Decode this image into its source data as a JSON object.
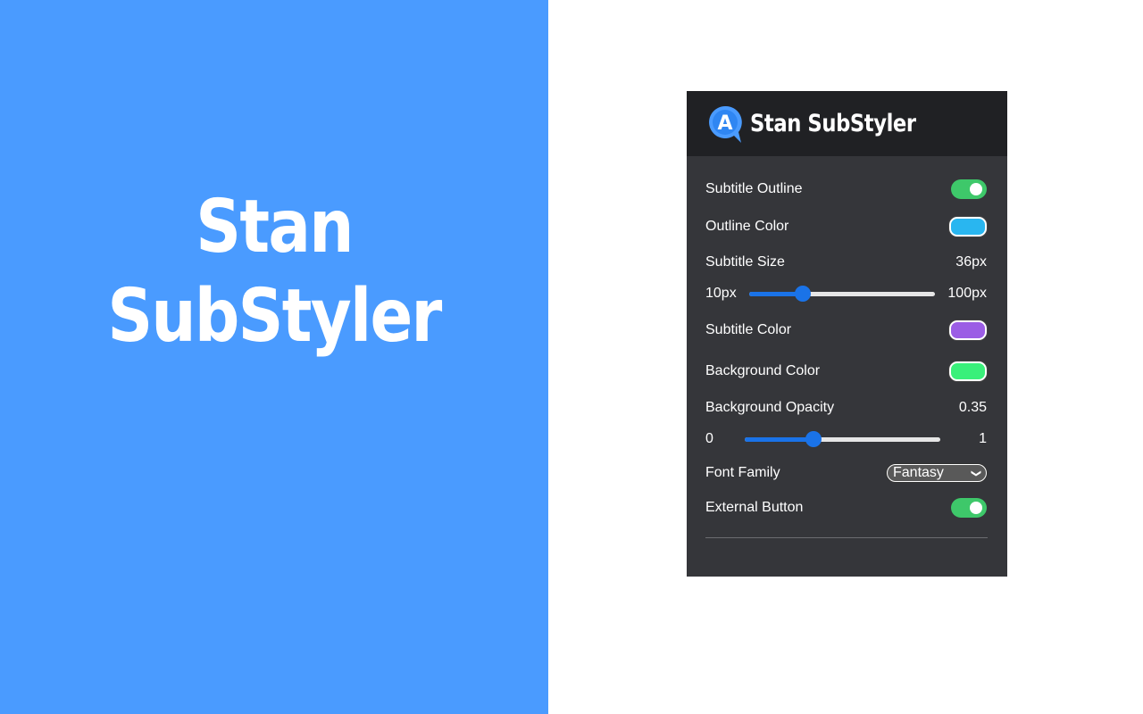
{
  "hero": {
    "title": "Stan SubStyler"
  },
  "popup": {
    "header_title": "Stan SubStyler",
    "logo_letter": "A",
    "settings": {
      "subtitle_outline": {
        "label": "Subtitle Outline",
        "enabled": true
      },
      "outline_color": {
        "label": "Outline Color",
        "color": "#29b6f0"
      },
      "subtitle_size": {
        "label": "Subtitle Size",
        "value": "36px",
        "min": "10px",
        "max": "100px",
        "fraction": 0.289
      },
      "subtitle_color": {
        "label": "Subtitle Color",
        "color": "#9b5de5"
      },
      "background_color": {
        "label": "Background Color",
        "color": "#39f07a"
      },
      "background_opacity": {
        "label": "Background Opacity",
        "value": "0.35",
        "min": "0",
        "max": "1",
        "fraction": 0.35
      },
      "font_family": {
        "label": "Font Family",
        "selected": "Fantasy"
      },
      "external_button": {
        "label": "External Button",
        "enabled": true
      }
    }
  },
  "colors": {
    "left_panel": "#4a9bff",
    "popup_bg": "#35363a",
    "header_bg": "#202124",
    "toggle_on": "#3ec86a",
    "slider_accent": "#1a73e8"
  }
}
